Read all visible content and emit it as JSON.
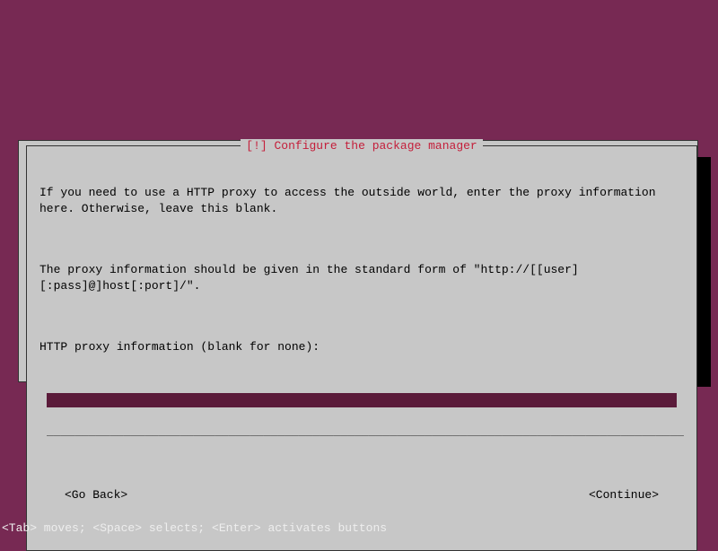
{
  "dialog": {
    "title_prefix": "[!]",
    "title_text": "Configure the package manager",
    "paragraph1": "If you need to use a HTTP proxy to access the outside world, enter the proxy information here. Otherwise, leave this blank.",
    "paragraph2": "The proxy information should be given in the standard form of \"http://[[user][:pass]@]host[:port]/\".",
    "prompt": "HTTP proxy information (blank for none):",
    "input_value": "",
    "underline": "___________________________________________________________________________________________",
    "go_back_label": "<Go Back>",
    "continue_label": "<Continue>"
  },
  "help_bar": "<Tab> moves; <Space> selects; <Enter> activates buttons"
}
